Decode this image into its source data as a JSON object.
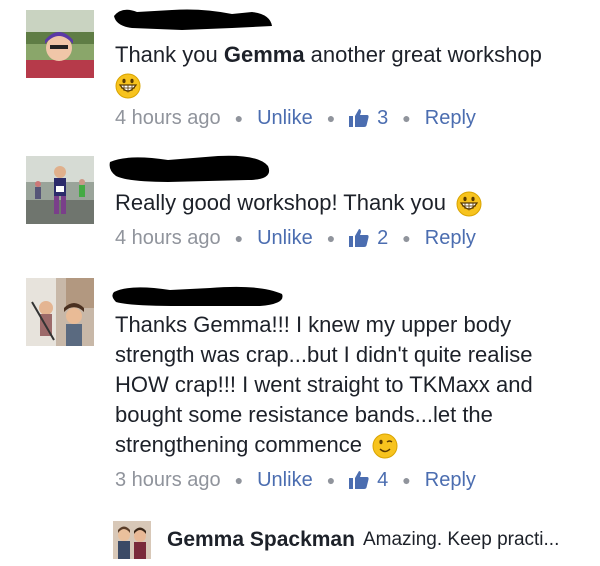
{
  "comments": [
    {
      "text_prefix": "Thank you ",
      "text_bold": "Gemma",
      "text_suffix": " another great workshop",
      "emoji": "grinning-face",
      "time": "4 hours ago",
      "unlike": "Unlike",
      "likes": "3",
      "reply": "Reply"
    },
    {
      "text": "Really good workshop! Thank you",
      "emoji": "grinning-face",
      "time": "4 hours ago",
      "unlike": "Unlike",
      "likes": "2",
      "reply": "Reply"
    },
    {
      "lines": [
        "Thanks Gemma!!! I knew my upper body",
        "strength was crap...but I didn't quite realise",
        "HOW crap!!! I went straight to TKMaxx and",
        "bought some resistance bands...let the",
        "strengthening commence"
      ],
      "emoji": "winking-face",
      "time": "3 hours ago",
      "unlike": "Unlike",
      "likes": "4",
      "reply": "Reply"
    }
  ],
  "reply_preview": {
    "name": "Gemma Spackman",
    "text": "Amazing. Keep practi..."
  },
  "colors": {
    "link": "#4b6db0",
    "meta": "#90949c",
    "text": "#1d2129"
  }
}
